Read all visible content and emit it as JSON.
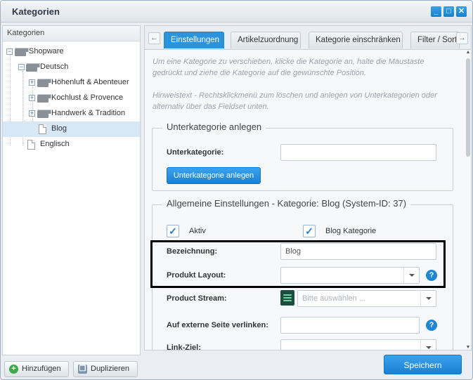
{
  "window": {
    "title": "Kategorien",
    "buttons": [
      "_",
      "□",
      "✕"
    ]
  },
  "left": {
    "header": "Kategorien",
    "tree": [
      {
        "label": "Shopware",
        "icon": "folder-icon",
        "expander": "−"
      },
      {
        "label": "Deutsch",
        "icon": "folder-icon",
        "expander": "−"
      },
      {
        "label": "Höhenluft & Abenteuer",
        "icon": "folder-icon",
        "expander": "+"
      },
      {
        "label": "Kochlust & Provence",
        "icon": "folder-icon",
        "expander": "+"
      },
      {
        "label": "Handwerk & Tradition",
        "icon": "folder-icon",
        "expander": "+"
      },
      {
        "label": "Blog",
        "icon": "document-icon",
        "selected": true
      },
      {
        "label": "Englisch",
        "icon": "document-icon"
      }
    ],
    "footer": {
      "add_label": "Hinzufügen",
      "duplicate_label": "Duplizieren"
    }
  },
  "tabs": {
    "prev": "←",
    "next": "→",
    "items": [
      "Einstellungen",
      "Artikelzuordnung",
      "Kategorie einschränken",
      "Filter / Sortierung"
    ],
    "active": "Einstellungen"
  },
  "hints": {
    "move": "Um eine Kategorie zu verschieben, klicke die Kategorie an, halte die Maustaste gedrückt und ziehe die Kategorie auf die gewünschte Position.",
    "context": "Hinweistext - Rechtsklickmenü zum löschen und anlegen von Unterkategorien oder alternativ über das Fieldset unten."
  },
  "sub_fieldset": {
    "legend": "Unterkategorie anlegen",
    "field_label": "Unterkategorie:",
    "field_value": "",
    "button_label": "Unterkategorie anlegen"
  },
  "general": {
    "legend": "Allgemeine Einstellungen - Kategorie: Blog (System-ID: 37)",
    "active_label": "Aktiv",
    "active_checked": true,
    "blog_label": "Blog Kategorie",
    "blog_checked": true,
    "name_label": "Bezeichnung:",
    "name_value": "Blog",
    "layout_label": "Produkt Layout:",
    "layout_value": "",
    "stream_label": "Product Stream:",
    "stream_placeholder": "Bitte auswählen ...",
    "external_label": "Auf externe Seite verlinken:",
    "external_value": "",
    "target_label": "Link-Ziel:",
    "target_value": "",
    "help": "?",
    "check": "✓"
  },
  "save_label": "Speichern",
  "colors": {
    "accent": "#2b92dc",
    "highlight": "#000000"
  }
}
